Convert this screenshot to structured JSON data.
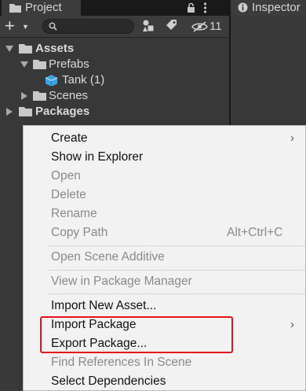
{
  "project_panel": {
    "tab_label": "Project",
    "search": {
      "value": "",
      "placeholder": ""
    },
    "hidden_count": "11",
    "icons": {
      "tab": "folder-icon",
      "lock": "lock-icon",
      "menu": "kebab-menu-icon",
      "create": "plus-icon",
      "filter_type": "filter-by-type-icon",
      "filter_label": "filter-by-label-icon",
      "hidden": "eye-slash-icon"
    },
    "tree": [
      {
        "label": "Assets",
        "expanded": true,
        "bold": true
      },
      {
        "label": "Prefabs",
        "expanded": true,
        "bold": false
      },
      {
        "label": "Tank (1)",
        "bold": false,
        "icon": "prefab-cube-icon"
      },
      {
        "label": "Scenes",
        "expanded": false,
        "bold": false
      },
      {
        "label": "Packages",
        "expanded": false,
        "bold": true
      }
    ]
  },
  "inspector_panel": {
    "tab_label": "Inspector"
  },
  "context_menu": {
    "items": [
      {
        "label": "Create",
        "enabled": true,
        "submenu": true
      },
      {
        "label": "Show in Explorer",
        "enabled": true
      },
      {
        "label": "Open",
        "enabled": false
      },
      {
        "label": "Delete",
        "enabled": false
      },
      {
        "label": "Rename",
        "enabled": false
      },
      {
        "label": "Copy Path",
        "enabled": false,
        "shortcut": "Alt+Ctrl+C"
      },
      {
        "label": "Open Scene Additive",
        "enabled": false
      },
      {
        "label": "View in Package Manager",
        "enabled": false
      },
      {
        "label": "Import New Asset...",
        "enabled": true
      },
      {
        "label": "Import Package",
        "enabled": true,
        "submenu": true
      },
      {
        "label": "Export Package...",
        "enabled": true
      },
      {
        "label": "Find References In Scene",
        "enabled": false
      },
      {
        "label": "Select Dependencies",
        "enabled": true
      }
    ],
    "submenu_arrow": "›",
    "highlight_color": "#e8121c"
  },
  "colors": {
    "panel_bg": "#383838",
    "tab_bar_bg": "#191919",
    "menu_bg": "#f2f2f2",
    "disabled_text": "#8a8a8a"
  }
}
